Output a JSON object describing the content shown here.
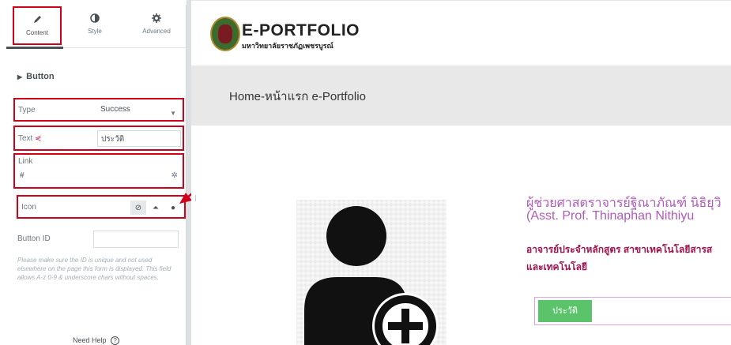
{
  "panel": {
    "tabs": [
      {
        "label": "Content",
        "icon": "pencil-icon"
      },
      {
        "label": "Style",
        "icon": "half-circle-icon"
      },
      {
        "label": "Advanced",
        "icon": "gear-icon"
      }
    ],
    "section_title": "Button",
    "type": {
      "label": "Type",
      "value": "Success"
    },
    "text": {
      "label": "Text",
      "value": "ประวัติ"
    },
    "link": {
      "label": "Link",
      "value": "#"
    },
    "icon": {
      "label": "Icon"
    },
    "button_id": {
      "label": "Button ID",
      "value": ""
    },
    "help_text": "Please make sure the ID is unique and not used elsewhere on the page this form is displayed. This field allows A-z 0-9 & underscore chars without spaces.",
    "need_help": "Need Help"
  },
  "site": {
    "brand_title": "E-PORTFOLIO",
    "brand_subtitle": "มหาวิทยาลัยราชภัฏเพชรบูรณ์",
    "hero_title": "Home-หน้าแรก e-Portfolio",
    "prof_name_th": "ผู้ช่วยศาสตราจารย์ฐิณาภัณฑ์ นิธิยุวิ",
    "prof_name_en": "(Asst. Prof. Thinaphan Nithiyu",
    "prof_role_line1": "อาจารย์ประจำหลักสูตร สาขาเทคโนโลยีสารส",
    "prof_role_line2": "และเทคโนโลยี",
    "bio_button": "ประวัติ"
  },
  "colors": {
    "highlight": "#d0021b",
    "button_green": "#5bc46a",
    "name_purple": "#b05bb9",
    "role_red": "#a3124f"
  }
}
